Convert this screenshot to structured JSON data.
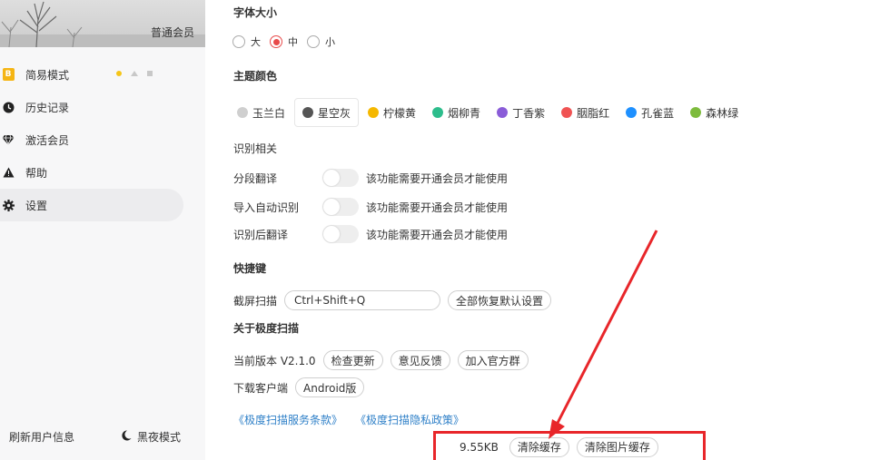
{
  "sidebar": {
    "member_label": "普通会员",
    "nav": [
      {
        "label": "简易模式",
        "icon": "badge-b-icon"
      },
      {
        "label": "历史记录",
        "icon": "clock-icon"
      },
      {
        "label": "激活会员",
        "icon": "diamond-icon"
      },
      {
        "label": "帮助",
        "icon": "warning-triangle-icon"
      },
      {
        "label": "设置",
        "icon": "gear-icon",
        "active": true
      }
    ],
    "footer": {
      "refresh_label": "刷新用户信息",
      "night_mode_label": "黑夜模式"
    }
  },
  "settings": {
    "font_size": {
      "heading": "字体大小",
      "options": [
        "大",
        "中",
        "小"
      ],
      "selected": "中"
    },
    "theme": {
      "heading": "主题颜色",
      "options": [
        {
          "label": "玉兰白",
          "color": "#cfcfcf"
        },
        {
          "label": "星空灰",
          "color": "#555555"
        },
        {
          "label": "柠檬黄",
          "color": "#f5b800"
        },
        {
          "label": "烟柳青",
          "color": "#2dbd8c"
        },
        {
          "label": "丁香紫",
          "color": "#8a5cd8"
        },
        {
          "label": "胭脂红",
          "color": "#f05353"
        },
        {
          "label": "孔雀蓝",
          "color": "#1e90ff"
        },
        {
          "label": "森林绿",
          "color": "#7dbb3c"
        }
      ],
      "selected": "星空灰"
    },
    "recognition": {
      "heading": "识别相关",
      "toggles": [
        {
          "label": "分段翻译",
          "note": "该功能需要开通会员才能使用"
        },
        {
          "label": "导入自动识别",
          "note": "该功能需要开通会员才能使用"
        },
        {
          "label": "识别后翻译",
          "note": "该功能需要开通会员才能使用"
        }
      ]
    },
    "shortcuts": {
      "heading": "快捷键",
      "label": "截屏扫描",
      "value": "Ctrl+Shift+Q",
      "reset_button": "全部恢复默认设置"
    },
    "about": {
      "heading": "关于极度扫描",
      "version_label": "当前版本 V2.1.0",
      "check_update": "检查更新",
      "feedback": "意见反馈",
      "join_group": "加入官方群",
      "download_label": "下载客户端",
      "android_button": "Android版",
      "terms_link": "《极度扫描服务条款》",
      "privacy_link": "《极度扫描隐私政策》"
    },
    "cache": {
      "size": "9.55KB",
      "clear_cache": "清除缓存",
      "clear_image_cache": "清除图片缓存"
    }
  },
  "colors": {
    "accent_red": "#e84a4a",
    "annotation_red": "#e8262a",
    "link_blue": "#2f80c8"
  }
}
